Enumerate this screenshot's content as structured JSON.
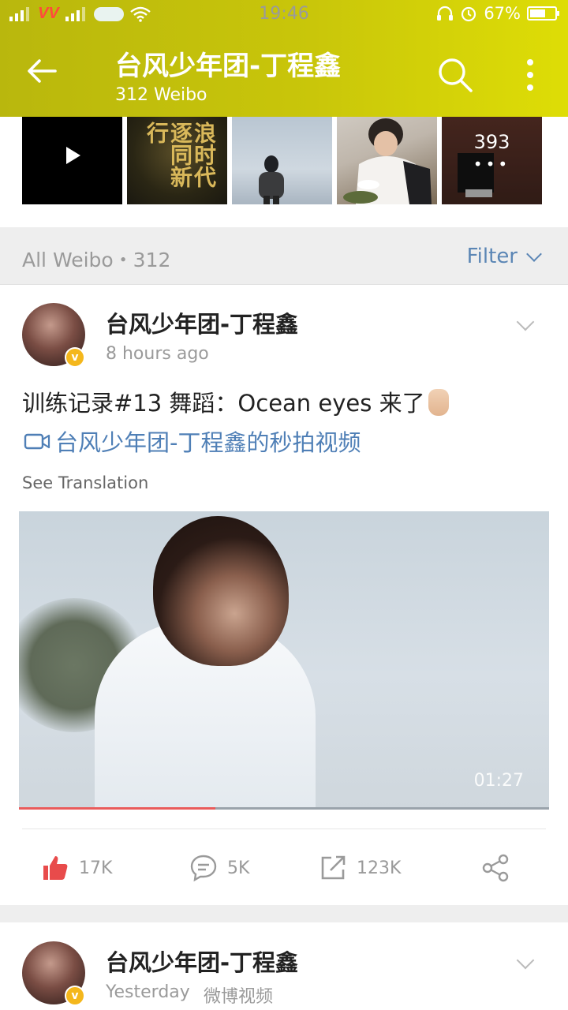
{
  "status_bar": {
    "time": "19:46",
    "carrier": "VIETTEL",
    "battery_percent": "67%",
    "battery_level": 0.67
  },
  "app_bar": {
    "title": "台风少年团-丁程鑫",
    "subtitle": "312 Weibo",
    "icons": [
      "back-arrow-icon",
      "search-icon",
      "more-vertical-icon"
    ]
  },
  "media_strip": {
    "poster_text": "浪时代逐同新行",
    "more_count": "393",
    "more_dots": "•••"
  },
  "section": {
    "title": "All Weibo・312",
    "filter_label": "Filter"
  },
  "post": {
    "author": "台风少年团-丁程鑫",
    "time": "8 hours ago",
    "text": "训练记录#13 舞蹈：Ocean eyes 来了",
    "video_link": "台风少年团-丁程鑫的秒拍视频",
    "see_translation": "See Translation",
    "video_duration": "01:27",
    "video_progress": 0.37,
    "likes": "17K",
    "comments": "5K",
    "reposts": "123K",
    "colors": {
      "like": "#e84b4b",
      "link": "#4f7fb6",
      "verified": "#f4b71c"
    }
  },
  "post2": {
    "author": "台风少年团-丁程鑫",
    "time": "Yesterday",
    "source": "微博视频"
  }
}
